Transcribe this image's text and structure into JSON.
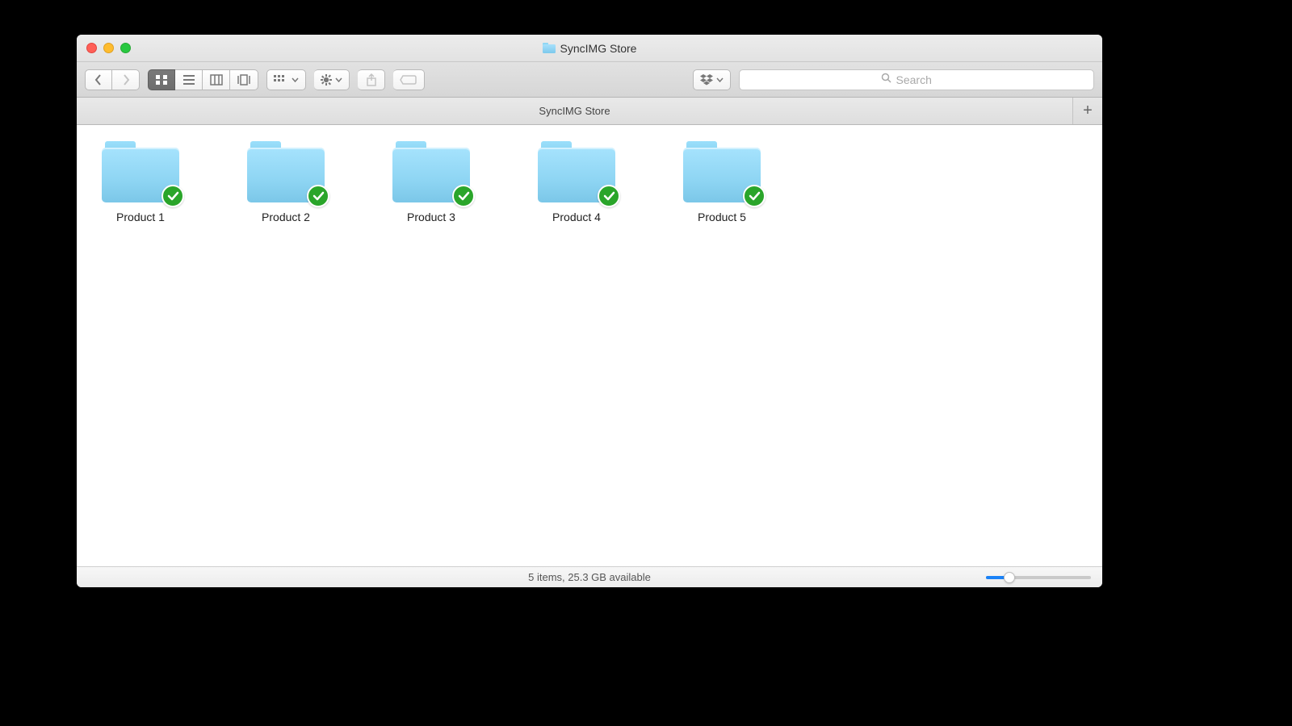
{
  "window": {
    "title": "SyncIMG Store",
    "tab_title": "SyncIMG Store"
  },
  "search": {
    "placeholder": "Search"
  },
  "status": {
    "text": "5 items, 25.3 GB available"
  },
  "folders": [
    {
      "name": "Product 1"
    },
    {
      "name": "Product 2"
    },
    {
      "name": "Product 3"
    },
    {
      "name": "Product 4"
    },
    {
      "name": "Product 5"
    }
  ]
}
